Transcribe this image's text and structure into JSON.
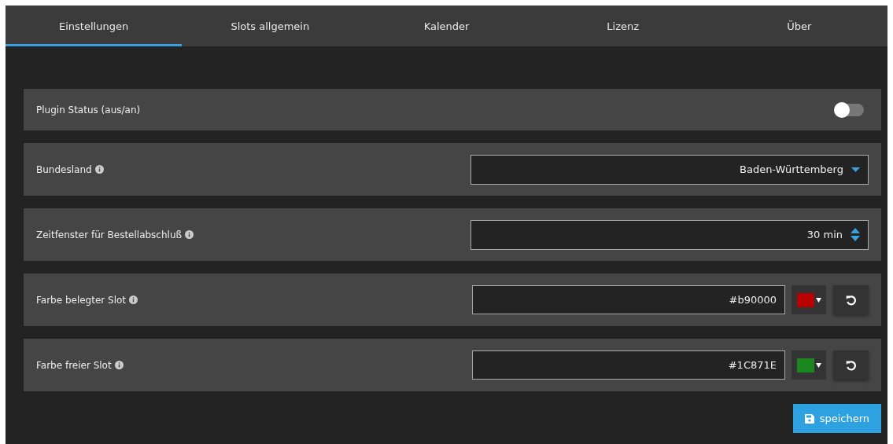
{
  "tabs": [
    {
      "label": "Einstellungen",
      "selected": true
    },
    {
      "label": "Slots allgemein",
      "selected": false
    },
    {
      "label": "Kalender",
      "selected": false
    },
    {
      "label": "Lizenz",
      "selected": false
    },
    {
      "label": "Über",
      "selected": false
    }
  ],
  "settings": [
    {
      "kind": "toggle",
      "label": "Plugin Status (aus/an)",
      "info": false,
      "on": false
    },
    {
      "kind": "select",
      "label": "Bundesland",
      "info": true,
      "value": "Baden-Württemberg"
    },
    {
      "kind": "number",
      "label": "Zeitfenster für Bestellabschluß",
      "info": true,
      "value": "30 min"
    },
    {
      "kind": "color",
      "label": "Farbe belegter Slot",
      "info": true,
      "value": "#b90000",
      "color": "#b90000"
    },
    {
      "kind": "color",
      "label": "Farbe freier Slot",
      "info": true,
      "value": "#1C871E",
      "color": "#1c871e"
    }
  ],
  "save_button": "speichern"
}
